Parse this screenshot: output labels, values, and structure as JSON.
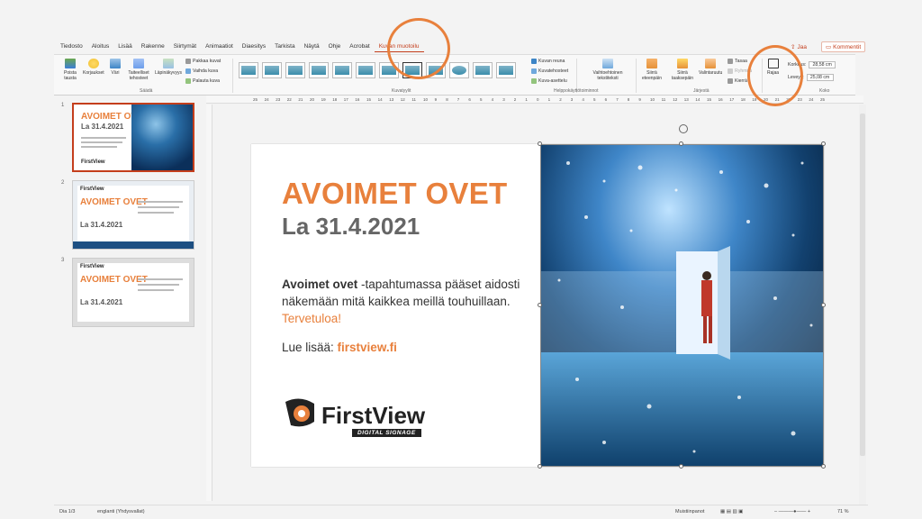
{
  "tabs": [
    "Tiedosto",
    "Aloitus",
    "Lisää",
    "Rakenne",
    "Siirtymät",
    "Animaatiot",
    "Diaesitys",
    "Tarkista",
    "Näytä",
    "Ohje",
    "Acrobat",
    "Kuvan muotoilu"
  ],
  "active_tab": "Kuvan muotoilu",
  "share_label": "Jaa",
  "comments_label": "Kommentit",
  "ribbon": {
    "remove_bg": "Poista tausta",
    "corrections": "Korjaukset",
    "color": "Väri",
    "artistic": "Taiteelliset tehosteet",
    "transparency": "Läpinäkyvyys",
    "compress": "Pakkaa kuvat",
    "change": "Vaihda kuva",
    "reset": "Palauta kuva",
    "group_adjust": "Säädä",
    "border": "Kuvan reuna",
    "effects": "Kuvatehosteet",
    "layout": "Kuva-asettelu",
    "group_styles": "Kuvatyylit",
    "alt_text": "Vaihtoehtoinen tekstiteksti",
    "group_access": "Helppokäyttötoiminnot",
    "bring_forward": "Siirrä eteenpäin",
    "send_back": "Siirrä taaksepäin",
    "selection_pane": "Valintaruutu",
    "align": "Tasaa",
    "group": "Ryhmitä",
    "rotate": "Kierrä",
    "group_arrange": "Järjestä",
    "crop": "Rajaa",
    "height_label": "Korkeus:",
    "height_value": "28,58 cm",
    "width_label": "Leveys:",
    "width_value": "25,08 cm",
    "group_size": "Koko"
  },
  "ruler_ticks": [
    "25",
    "24",
    "23",
    "22",
    "21",
    "20",
    "19",
    "18",
    "17",
    "16",
    "15",
    "14",
    "13",
    "12",
    "11",
    "10",
    "9",
    "8",
    "7",
    "6",
    "5",
    "4",
    "3",
    "2",
    "1",
    "0",
    "1",
    "2",
    "3",
    "4",
    "5",
    "6",
    "7",
    "8",
    "9",
    "10",
    "11",
    "12",
    "13",
    "14",
    "15",
    "16",
    "17",
    "18",
    "19",
    "20",
    "21",
    "22",
    "23",
    "24",
    "25"
  ],
  "thumbnails": [
    {
      "num": "1",
      "title": "AVOIMET OVET",
      "date": "La 31.4.2021",
      "logo": "FirstView"
    },
    {
      "num": "2",
      "title": "AVOIMET OVET",
      "date": "La 31.4.2021",
      "logo": "FirstView"
    },
    {
      "num": "3",
      "title": "AVOIMET OVET",
      "date": "La 31.4.2021",
      "logo": "FirstView"
    }
  ],
  "slide": {
    "title": "AVOIMET OVET",
    "date": "La 31.4.2021",
    "body_bold": "Avoimet ovet",
    "body_text": " -tapahtumassa pääset aidosti näkemään mitä kaikkea meillä touhuillaan. ",
    "body_orange": "Tervetuloa!",
    "more_label": "Lue lisää: ",
    "more_link": "firstview.fi",
    "logo_first": "First",
    "logo_view": "View",
    "logo_tag": "DIGITAL SIGNAGE"
  },
  "status": {
    "slide_count": "Dia 1/3",
    "language": "englanti (Yhdysvallat)",
    "notes": "Muistiinpanot",
    "zoom": "71 %"
  },
  "colors": {
    "accent": "#e8803c",
    "ribbon_accent": "#c43e1c"
  }
}
